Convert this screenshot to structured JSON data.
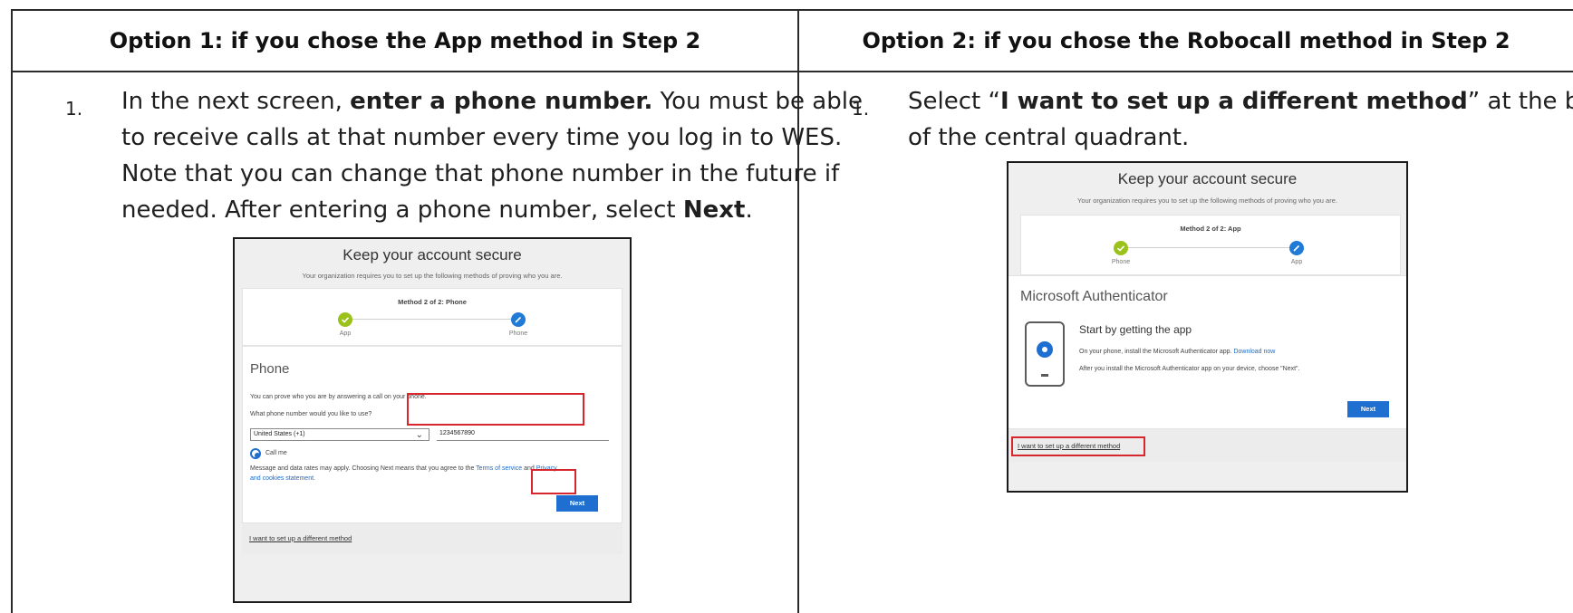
{
  "table": {
    "left_header": "Option 1: if you chose the App method in Step 2",
    "right_header": "Option 2: if you chose the Robocall method in Step 2"
  },
  "option1": {
    "step_number": "1.",
    "line1_a": "In the next screen, ",
    "line1_b": "enter a phone number.",
    "line1_c": " You must be able",
    "line2": "to receive calls at that number every time you log in to WES.",
    "line3": "Note that you can change that phone number in the future if",
    "line4_a": "needed. After entering a phone number, select ",
    "line4_b": "Next",
    "line4_c": ".",
    "screenshot": {
      "title": "Keep your account secure",
      "subtitle": "Your organization requires you to set up the following methods of proving who you are.",
      "method": "Method 2 of 2: Phone",
      "progress_left": "App",
      "progress_right": "Phone",
      "heading": "Phone",
      "line_a": "You can prove who you are by answering a call on your phone.",
      "line_b": "What phone number would you like to use?",
      "country": "United States (+1)",
      "phone_value": "1234567890",
      "radio_label": "Call me",
      "legal_a": "Message and data rates may apply. Choosing Next means that you agree to the ",
      "legal_terms": "Terms of service",
      "legal_and": " and ",
      "legal_privacy": "Privacy",
      "legal_b": "and cookies statement",
      "legal_end": ".",
      "next": "Next",
      "footer_link": "I want to set up a different method"
    }
  },
  "option2": {
    "step_number": "1.",
    "line1_a": "Select “",
    "line1_b": "I want to set up a different method",
    "line1_c": "” at the bottom",
    "line2": "of the central quadrant.",
    "screenshot": {
      "title": "Keep your account secure",
      "subtitle": "Your organization requires you to set up the following methods of proving who you are.",
      "method": "Method 2 of 2: App",
      "progress_left": "Phone",
      "progress_right": "App",
      "heading": "Microsoft Authenticator",
      "start": "Start by getting the app",
      "line_a": "On your phone, install the Microsoft Authenticator app. ",
      "download": "Download now",
      "line_b": "After you install the Microsoft Authenticator app on your device, choose \"Next\".",
      "next": "Next",
      "footer_link": "I want to set up a different method"
    }
  }
}
